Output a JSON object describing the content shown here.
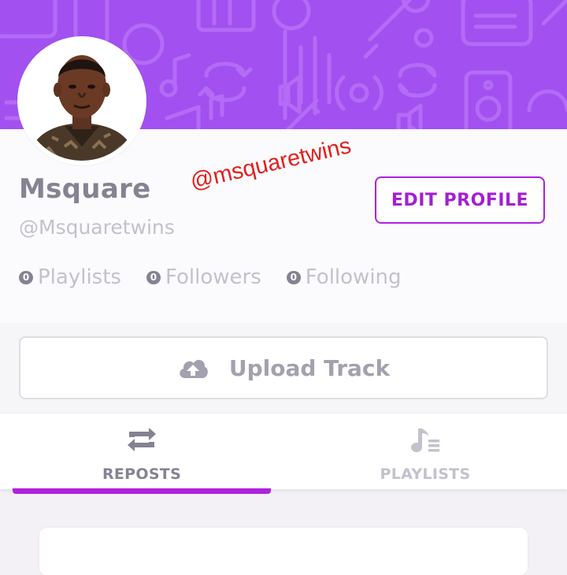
{
  "profile": {
    "display_name": "Msquare",
    "handle": "@Msquaretwins",
    "edit_button_label": "EDIT PROFILE"
  },
  "overlay_watermark": "@msquaretwins",
  "stats": [
    {
      "count": "0",
      "label": "Playlists"
    },
    {
      "count": "0",
      "label": "Followers"
    },
    {
      "count": "0",
      "label": "Following"
    }
  ],
  "upload": {
    "label": "Upload Track",
    "icon": "cloud-upload-icon"
  },
  "tabs": [
    {
      "label": "REPOSTS",
      "icon": "repost-icon",
      "active": true
    },
    {
      "label": "PLAYLISTS",
      "icon": "playlist-music-icon",
      "active": false
    }
  ],
  "colors": {
    "cover": "#a350f0",
    "accent": "#b020e0",
    "text_primary": "#858392",
    "text_muted": "#c3c1cb",
    "watermark": "#e0201d"
  }
}
